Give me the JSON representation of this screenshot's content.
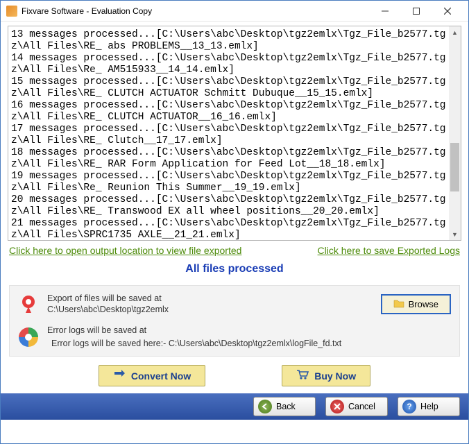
{
  "window": {
    "title": "Fixvare Software - Evaluation Copy"
  },
  "log_lines": [
    "13 messages processed...[C:\\Users\\abc\\Desktop\\tgz2emlx\\Tgz_File_b2577.tgz\\All Files\\RE_ abs PROBLEMS__13_13.emlx]",
    "14 messages processed...[C:\\Users\\abc\\Desktop\\tgz2emlx\\Tgz_File_b2577.tgz\\All Files\\Re_ AM515933__14_14.emlx]",
    "15 messages processed...[C:\\Users\\abc\\Desktop\\tgz2emlx\\Tgz_File_b2577.tgz\\All Files\\RE_ CLUTCH ACTUATOR Schmitt Dubuque__15_15.emlx]",
    "16 messages processed...[C:\\Users\\abc\\Desktop\\tgz2emlx\\Tgz_File_b2577.tgz\\All Files\\RE_ CLUTCH ACTUATOR__16_16.emlx]",
    "17 messages processed...[C:\\Users\\abc\\Desktop\\tgz2emlx\\Tgz_File_b2577.tgz\\All Files\\RE_ Clutch__17_17.emlx]",
    "18 messages processed...[C:\\Users\\abc\\Desktop\\tgz2emlx\\Tgz_File_b2577.tgz\\All Files\\RE_ RAR Form Application for Feed Lot__18_18.emlx]",
    "19 messages processed...[C:\\Users\\abc\\Desktop\\tgz2emlx\\Tgz_File_b2577.tgz\\All Files\\Re_ Reunion This Summer__19_19.emlx]",
    "20 messages processed...[C:\\Users\\abc\\Desktop\\tgz2emlx\\Tgz_File_b2577.tgz\\All Files\\RE_ Transwood EX all wheel positions__20_20.emlx]",
    "21 messages processed...[C:\\Users\\abc\\Desktop\\tgz2emlx\\Tgz_File_b2577.tgz\\All Files\\SPRC1735 AXLE__21_21.emlx]"
  ],
  "links": {
    "open_output": "Click here to open output location to view file exported",
    "save_logs": "Click here to save Exported Logs"
  },
  "status": "All files processed",
  "export": {
    "label": "Export of files will be saved at",
    "path": "C:\\Users\\abc\\Desktop\\tgz2emlx",
    "browse": "Browse"
  },
  "errorlog": {
    "label": "Error logs will be saved at",
    "detail": "Error logs will be saved here:- C:\\Users\\abc\\Desktop\\tgz2emlx\\logFile_fd.txt"
  },
  "buttons": {
    "convert": "Convert Now",
    "buy": "Buy Now",
    "back": "Back",
    "cancel": "Cancel",
    "help": "Help"
  }
}
